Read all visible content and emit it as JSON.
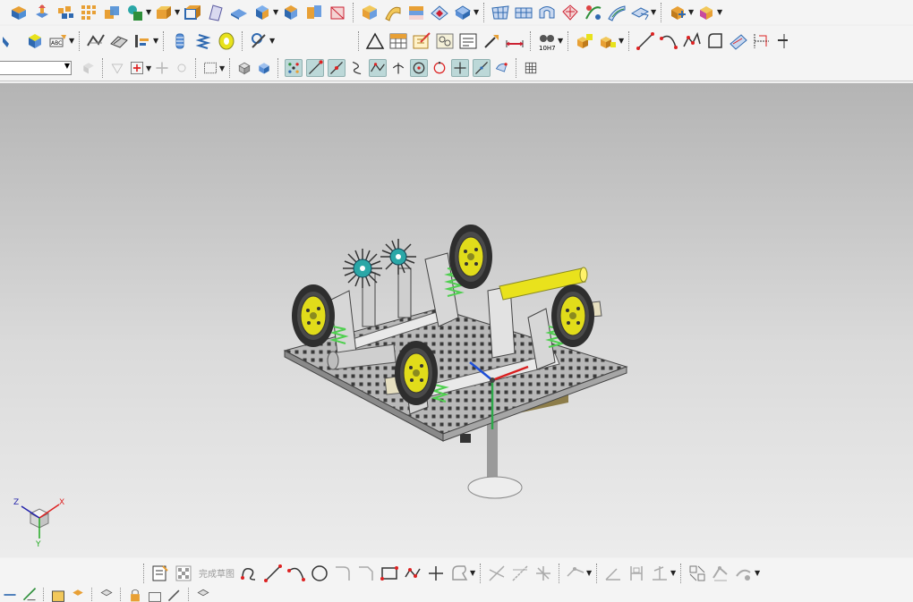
{
  "toolbar_rows": {
    "row1": [
      "block-icon",
      "extrude-icon",
      "feature-array-icon",
      "pattern-icon",
      "unite-icon",
      "shape-icon",
      "box-icon",
      "box-open-icon",
      "sheet-icon",
      "plane-icon",
      "solid-icon",
      "color-block-icon",
      "section-icon",
      "face-icon",
      "surface-icon",
      "sweep-icon",
      "layer-icon",
      "view-icon",
      "mesh-icon",
      "grid-surface-icon",
      "torus-icon",
      "ribbon-icon",
      "twist-icon",
      "sew-icon",
      "paint-icon",
      "feature-icon"
    ],
    "row2": [
      "bend-icon",
      "stack-icon",
      "text-icon",
      "curve-icon",
      "wave-icon",
      "bars-icon",
      "cylinder-icon",
      "spring-icon",
      "ring-icon",
      "wire-icon",
      "triangle-icon",
      "table-icon",
      "edit-icon",
      "cluster-icon",
      "note-icon",
      "drill-icon",
      "gauge-icon",
      "binocular-icon",
      "cubes-icon",
      "group-icon",
      "line-icon",
      "arc-icon",
      "polyline-icon",
      "shape-outline-icon",
      "ruler-icon",
      "dims-icon",
      "curve-alt-icon"
    ],
    "row3": [
      "cube-icon",
      "cube-shaded-icon",
      "snap-all-icon",
      "endpoint-icon",
      "midpoint-icon",
      "curve-snap-icon",
      "polyline-snap-icon",
      "intersect-icon",
      "center-icon",
      "quadrant-icon",
      "point-icon",
      "tangent-icon",
      "face-snap-icon",
      "grid-icon"
    ]
  },
  "sketch_toolbar": {
    "finish_sketch": "完成草图"
  },
  "triad": {
    "x": "X",
    "y": "Y",
    "z": "Z"
  },
  "colors": {
    "accent": "#2f69b0",
    "wheel_tire": "#2e2e2e",
    "wheel_hub": "#e1dc1a",
    "plate": "#b8b8b8",
    "spring": "#4fcf4f",
    "gear": "#2aa7a7",
    "roller": "#e9e21c"
  }
}
